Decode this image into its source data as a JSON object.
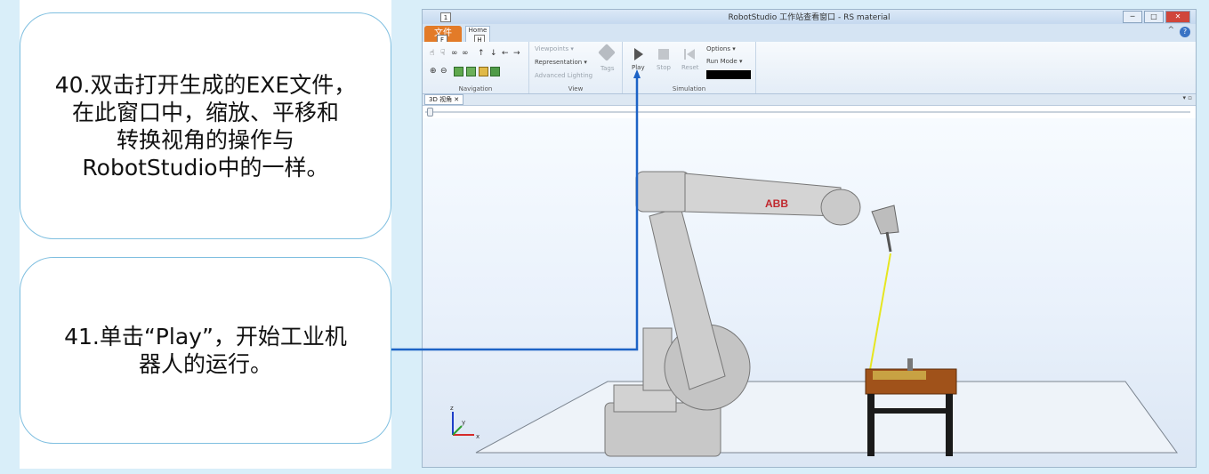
{
  "callouts": {
    "step40": {
      "line1": "40.双击打开生成的EXE文件，",
      "line2": "在此窗口中，缩放、平移和",
      "line3": "转换视角的操作与",
      "line4": "RobotStudio中的一样。"
    },
    "step41": {
      "line1": "41.单击“Play”，开始工业机",
      "line2": "器人的运行。"
    }
  },
  "window": {
    "title": "RobotStudio 工作站查看窗口 - RS material",
    "controls": {
      "minimize": "─",
      "maximize": "□",
      "close": "✕"
    },
    "tabs": {
      "file": "文件",
      "home": "Home"
    },
    "keytips": {
      "qat": "1",
      "file": "F",
      "home": "H"
    }
  },
  "ribbon": {
    "navigation": {
      "label": "Navigation"
    },
    "view": {
      "label": "View",
      "viewpoints": "Viewpoints ▾",
      "representation": "Representation ▾",
      "advanced_lighting": "Advanced Lighting",
      "tags": "Tags"
    },
    "simulation": {
      "label": "Simulation",
      "play": "Play",
      "stop": "Stop",
      "reset": "Reset",
      "options": "Options ▾",
      "run_mode": "Run Mode ▾"
    }
  },
  "document": {
    "tab": "3D 视角 ✕",
    "pin": "▾ ▫"
  },
  "scene": {
    "robot_brand": "ABB",
    "axes": {
      "z": "z",
      "y": "y",
      "x": "x"
    }
  },
  "colors": {
    "accent_file_tab": "#e37b28",
    "connector": "#1d63c6",
    "callout_border": "#7fbfe0",
    "robot": "#c9c9c9",
    "table": "#a0521a"
  }
}
